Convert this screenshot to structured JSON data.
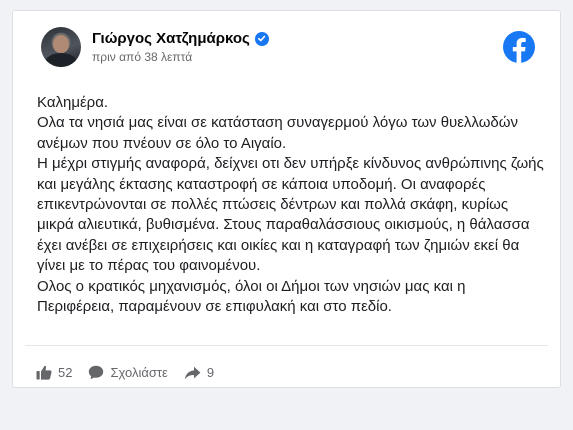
{
  "post": {
    "author": "Γιώργος Χατζημάρκος",
    "timestamp": "πριν από 38 λεπτά",
    "paragraphs": [
      "Καλημέρα.",
      "Ολα τα νησιά μας είναι σε κατάσταση συναγερμού λόγω των θυελλωδών",
      "ανέμων που πνέουν σε όλο το Αιγαίο.",
      "Η μέχρι στιγμής αναφορά, δείχνει οτι δεν υπήρξε κίνδυνος ανθρώπινης ζωής",
      "και μεγάλης έκτασης καταστροφή σε κάποια υποδομή. Οι αναφορές",
      "επικεντρώνονται σε πολλές πτώσεις δέντρων και πολλά σκάφη, κυρίως",
      "μικρά αλιευτικά, βυθισμένα. Στους παραθαλάσσιους οικισμούς, η θάλασσα",
      "έχει ανέβει σε επιχειρήσεις και οικίες και η καταγραφή των ζημιών εκεί θα",
      "γίνει με το πέρας του φαινομένου.",
      "Ολος ο κρατικός μηχανισμός, όλοι οι Δήμοι των νησιών μας και η",
      "Περιφέρεια, παραμένουν σε επιφυλακή και στο πεδίο."
    ]
  },
  "actions": {
    "likes_count": "52",
    "comment_label": "Σχολιάστε",
    "shares_count": "9"
  },
  "icons": {
    "verified": "verified-badge-icon",
    "facebook": "facebook-logo-icon",
    "like": "thumbs-up-icon",
    "comment": "speech-bubble-icon",
    "share": "share-arrow-icon"
  },
  "colors": {
    "brand": "#1877f2",
    "text": "#1c1e21",
    "muted": "#65676b"
  }
}
